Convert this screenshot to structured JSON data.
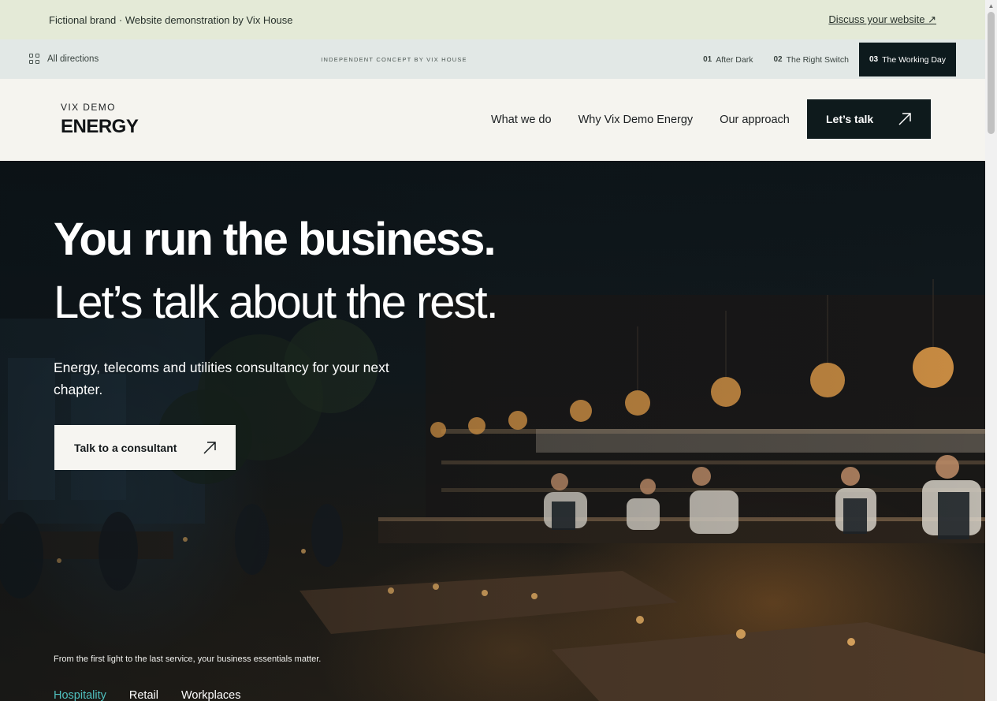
{
  "topbar": {
    "note": "Fictional brand · Website demonstration by Vix House",
    "link": "Discuss your website ↗"
  },
  "directions": {
    "all_label": "All directions",
    "center_label": "INDEPENDENT CONCEPT BY VIX HOUSE",
    "tabs": [
      {
        "num": "01",
        "label": "After Dark"
      },
      {
        "num": "02",
        "label": "The Right Switch"
      },
      {
        "num": "03",
        "label": "The Working Day"
      }
    ]
  },
  "header": {
    "logo_small": "VIX DEMO",
    "logo_big": "ENERGY",
    "nav": [
      "What we do",
      "Why Vix Demo Energy",
      "Our approach"
    ],
    "cta_label": "Let’s talk"
  },
  "hero": {
    "title_line1": "You run the business.",
    "title_line2": "Let’s talk about the rest.",
    "subtitle": "Energy, telecoms and utilities consultancy for your next chapter.",
    "button_label": "Talk to a consultant",
    "tagline": "From the first light to the last service, your business essentials matter.",
    "categories": [
      "Hospitality",
      "Retail",
      "Workplaces"
    ]
  },
  "colors": {
    "topbar_bg": "#e4ead7",
    "dirbar_bg": "#e2e8e6",
    "header_bg": "#f5f4ef",
    "dark": "#0e1a1c",
    "accent": "#4fc0be"
  }
}
